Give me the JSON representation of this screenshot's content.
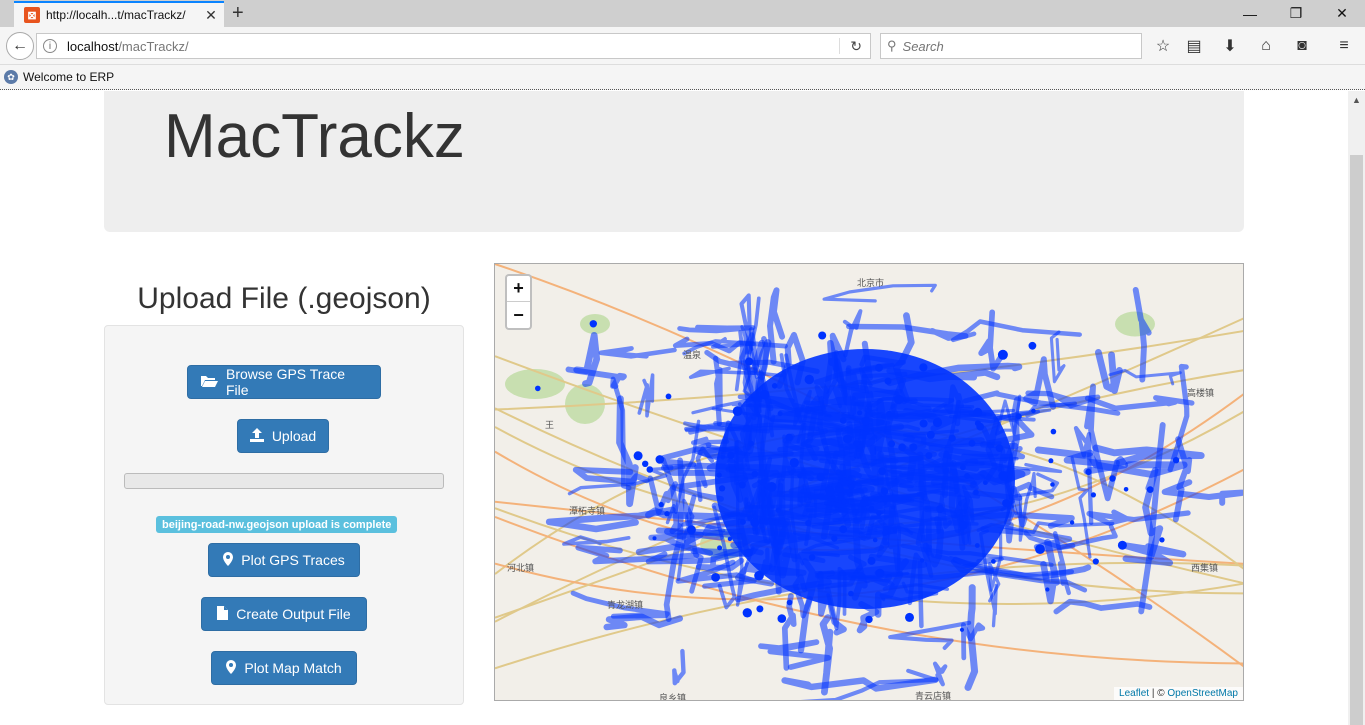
{
  "browser": {
    "tab_title": "http://localh...t/macTrackz/",
    "url_host": "localhost",
    "url_path": "/macTrackz/",
    "search_placeholder": "Search",
    "bookmark_label": "Welcome to ERP"
  },
  "page": {
    "title": "MacTrackz",
    "upload_heading": "Upload File (.geojson)",
    "buttons": {
      "browse": "Browse GPS Trace File",
      "upload": "Upload",
      "plot_gps": "Plot GPS Traces",
      "create_output": "Create Output File",
      "plot_map_match": "Plot Map Match"
    },
    "upload_status": "beijing-road-nw.geojson upload is complete",
    "progress_fraction": 0
  },
  "map": {
    "zoom_in": "+",
    "zoom_out": "−",
    "attribution_leaflet": "Leaflet",
    "attribution_sep": " | © ",
    "attribution_osm": "OpenStreetMap",
    "trace_color": "#0033ff",
    "places": {
      "p1": "北京市",
      "p2": "高楼镇",
      "p3": "王",
      "p4": "河北镇",
      "p5": "青龙湖镇",
      "p6": "良乡镇",
      "p7": "青云店镇",
      "p8": "西集镇",
      "p9": "温泉",
      "p10": "潭柘寺镇"
    }
  },
  "colors": {
    "primary": "#337ab7",
    "info": "#5bc0de",
    "jumbotron": "#eeeeee",
    "firefox_accent": "#0a84ff"
  }
}
